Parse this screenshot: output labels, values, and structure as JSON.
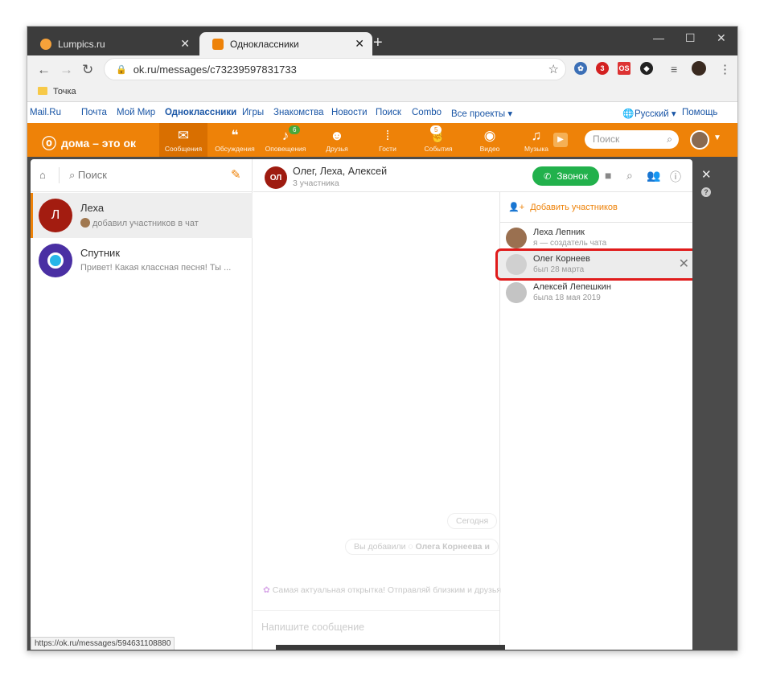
{
  "browser": {
    "tabs": [
      {
        "label": "Lumpics.ru",
        "favicon_color": "#f6a23a"
      },
      {
        "label": "Одноклассники",
        "favicon_color": "#ee8208"
      }
    ],
    "url": "ok.ru/messages/c73239597831733",
    "extension_badge": "3",
    "bookmark": "Точка"
  },
  "portal": {
    "links": [
      "Mail.Ru",
      "Почта",
      "Мой Мир",
      "Одноклассники",
      "Игры",
      "Знакомства",
      "Новости",
      "Поиск",
      "Combo",
      "Все проекты ▾"
    ],
    "language": "Русский ▾",
    "help": "Помощь"
  },
  "ok": {
    "logo": "дома – это ок",
    "nav": [
      {
        "label": "Сообщения",
        "icon": "mail-icon",
        "glyph": "✉"
      },
      {
        "label": "Обсуждения",
        "icon": "discussions-icon",
        "glyph": "💬"
      },
      {
        "label": "Оповещения",
        "icon": "bell-icon",
        "glyph": "🔔",
        "badge": "6"
      },
      {
        "label": "Друзья",
        "icon": "friends-icon",
        "glyph": "👥"
      },
      {
        "label": "Гости",
        "icon": "guests-icon",
        "glyph": "👣"
      },
      {
        "label": "События",
        "icon": "events-icon",
        "glyph": "👍",
        "badge": "5"
      },
      {
        "label": "Видео",
        "icon": "video-icon",
        "glyph": "🎥"
      },
      {
        "label": "Музыка",
        "icon": "music-icon",
        "glyph": "♫"
      }
    ],
    "search_placeholder": "Поиск",
    "accent": "#ee8208"
  },
  "messages": {
    "search_placeholder": "Поиск",
    "chats": [
      {
        "initial": "Л",
        "name": "Леха",
        "preview": "добавил участников в чат",
        "avatar_color": "#a31c10"
      },
      {
        "initial": "",
        "name": "Спутник",
        "preview": "Привет! Какая классная песня! Ты ...",
        "avatar_color": "#4a2fa3"
      }
    ],
    "status_url": "https://ok.ru/messages/594631108880",
    "conversation": {
      "avatar_initials": "ОЛ",
      "title": "Олег, Леха, Алексей",
      "subtitle": "3 участника",
      "call_label": "Звонок",
      "date_divider": "Сегодня",
      "system_prefix": "Вы добавили",
      "system_name": "Олега Корнеева и",
      "promo": "Самая актуальная открытка! Отправляй близким и друзья",
      "input_placeholder": "Напишите сообщение"
    },
    "participants": {
      "add_label": "Добавить участников",
      "members": [
        {
          "name": "Леха Лепник",
          "status": "я — создатель чата",
          "avatar_color": "#9a7050"
        },
        {
          "name": "Олег Корнеев",
          "status": "был 28 марта",
          "avatar_color": "#d0d0d0"
        },
        {
          "name": "Алексей Лепешкин",
          "status": "была 18 мая 2019",
          "avatar_color": "#c4c4c4"
        }
      ]
    }
  }
}
